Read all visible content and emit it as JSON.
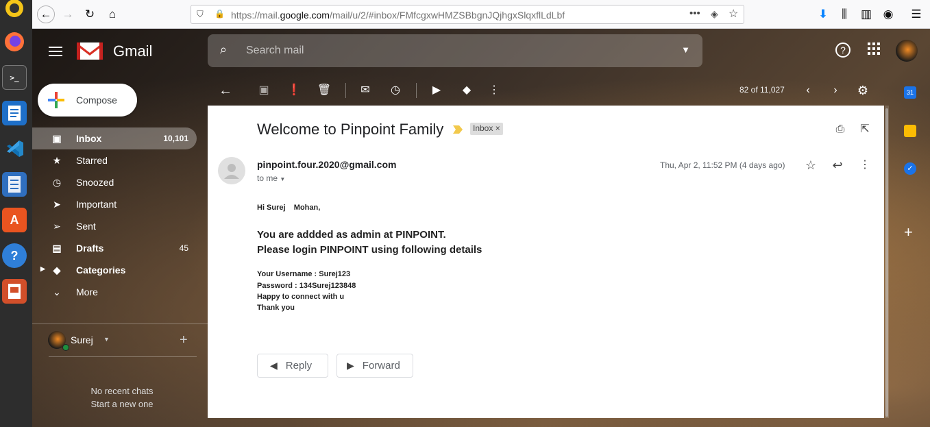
{
  "browser": {
    "url_prefix": "https://mail.",
    "url_domain": "google.com",
    "url_path": "/mail/u/2/#inbox/FMfcgxwHMZSBbgnJQjhgxSlqxflLdLbf"
  },
  "header": {
    "app_name": "Gmail",
    "search_placeholder": "Search mail"
  },
  "sidebar": {
    "compose_label": "Compose",
    "items": [
      {
        "label": "Inbox",
        "count": "10,101",
        "icon": "inbox-icon"
      },
      {
        "label": "Starred",
        "count": "",
        "icon": "star-icon"
      },
      {
        "label": "Snoozed",
        "count": "",
        "icon": "clock-icon"
      },
      {
        "label": "Important",
        "count": "",
        "icon": "important-icon"
      },
      {
        "label": "Sent",
        "count": "",
        "icon": "send-icon"
      },
      {
        "label": "Drafts",
        "count": "45",
        "icon": "draft-icon"
      },
      {
        "label": "Categories",
        "count": "",
        "icon": "label-icon"
      },
      {
        "label": "More",
        "count": "",
        "icon": "chevron-down-icon"
      }
    ],
    "chat_user": "Surej",
    "no_chats": "No recent chats",
    "start_chat": "Start a new one"
  },
  "toolbar": {
    "pagination": "82 of 11,027"
  },
  "email": {
    "subject": "Welcome to Pinpoint Family",
    "label": "Inbox ×",
    "sender": "pinpoint.four.2020@gmail.com",
    "to": "to me",
    "date": "Thu, Apr 2, 11:52 PM (4 days ago)",
    "greeting": "Hi Surej    Mohan,",
    "line1": "You are addded as admin at PINPOINT.",
    "line2": "Please login PINPOINT using following details",
    "username": "Your Username : Surej123",
    "password": "Password : 134Surej123848",
    "happy": "Happy to connect with u",
    "thanks": "Thank you",
    "reply_label": "Reply",
    "forward_label": "Forward"
  },
  "colors": {
    "gmail_red": "#d93025",
    "label_yellow": "#f2c94c"
  }
}
